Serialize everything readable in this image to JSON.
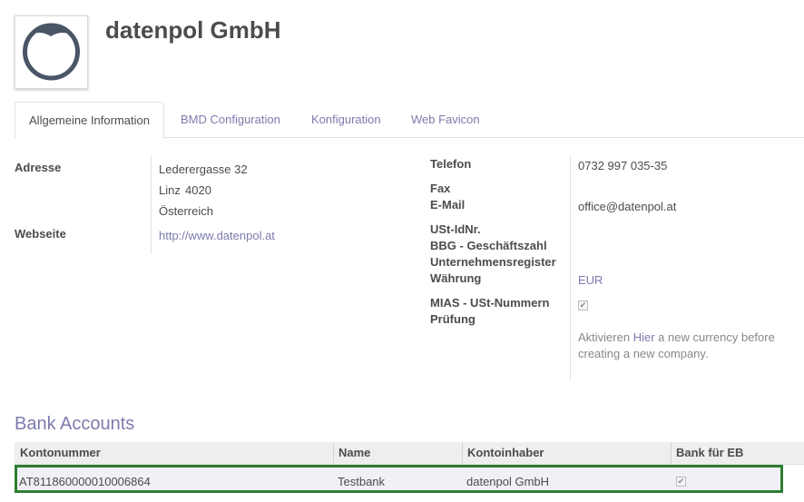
{
  "header": {
    "company_name": "datenpol GmbH",
    "logo_icon": "avatar-placeholder-icon"
  },
  "tabs": [
    {
      "label": "Allgemeine Information",
      "active": true
    },
    {
      "label": "BMD Configuration",
      "active": false
    },
    {
      "label": "Konfiguration",
      "active": false
    },
    {
      "label": "Web Favicon",
      "active": false
    }
  ],
  "left": {
    "address_label": "Adresse",
    "street": "Lederergasse 32",
    "city": "Linz",
    "zip": "4020",
    "country": "Österreich",
    "website_label": "Webseite",
    "website": "http://www.datenpol.at"
  },
  "right": {
    "phone_label": "Telefon",
    "phone": "0732 997 035-35",
    "fax_label": "Fax",
    "email_label": "E-Mail",
    "email": "office@datenpol.at",
    "vat_label": "USt-IdNr.",
    "bbg_label": "BBG - Geschäftszahl",
    "register_label": "Unternehmensregister",
    "currency_label": "Währung",
    "currency": "EUR",
    "mias_label_1": "MIAS - USt-Nummern",
    "mias_label_2": "Prüfung",
    "mias_checked": true,
    "currency_hint_1": "Aktivieren",
    "currency_hint_link": "Hier",
    "currency_hint_2": "a new currency before",
    "currency_hint_3": "creating a new company."
  },
  "bank": {
    "section_title": "Bank Accounts",
    "columns": [
      "Kontonummer",
      "Name",
      "Kontoinhaber",
      "Bank für EB"
    ],
    "rows": [
      {
        "account": "AT811860000010006864",
        "name": "Testbank",
        "holder": "datenpol GmbH",
        "eb": true
      }
    ]
  },
  "colors": {
    "accent": "#7c7bad",
    "selected_row_border": "#2f7d32"
  }
}
